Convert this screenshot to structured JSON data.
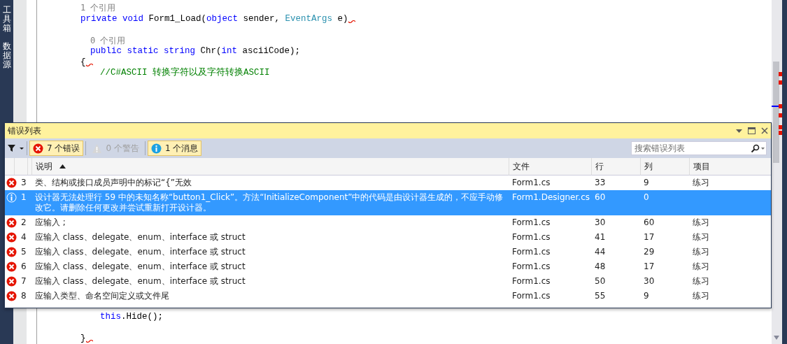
{
  "side_tabs": [
    {
      "label": "工具箱"
    },
    {
      "label": "数据源"
    }
  ],
  "code_lines": [
    {
      "kind": "lens",
      "text": "1 个引用"
    },
    {
      "kind": "code",
      "squiggle": true,
      "segments": [
        {
          "kind": "keyword",
          "text": "private void "
        },
        {
          "kind": "plain",
          "text": "Form1_Load("
        },
        {
          "kind": "keyword",
          "text": "object "
        },
        {
          "kind": "plain",
          "text": "sender, "
        },
        {
          "kind": "type",
          "text": "EventArgs "
        },
        {
          "kind": "plain",
          "text": "e)"
        }
      ]
    },
    {
      "kind": "blank"
    },
    {
      "kind": "lens",
      "text": "0 个引用"
    },
    {
      "kind": "code",
      "squiggle": false,
      "segments": [
        {
          "kind": "keyword",
          "text": "public static string "
        },
        {
          "kind": "plain",
          "text": "Chr("
        },
        {
          "kind": "keyword",
          "text": "int "
        },
        {
          "kind": "plain",
          "text": "asciiCode);"
        }
      ]
    },
    {
      "kind": "code",
      "squiggle": true,
      "segments": [
        {
          "kind": "plain",
          "text": "{"
        }
      ]
    },
    {
      "kind": "code",
      "squiggle": false,
      "segments": [
        {
          "kind": "comment",
          "text": "//C#ASCII 转换字符以及字符转换ASCII"
        }
      ]
    }
  ],
  "code_lines_below": [
    {
      "kind": "code",
      "squiggle": false,
      "segments": [
        {
          "kind": "keyword",
          "text": "this"
        },
        {
          "kind": "plain",
          "text": ".Hide();"
        }
      ]
    },
    {
      "kind": "blank"
    },
    {
      "kind": "code",
      "squiggle": true,
      "segments": [
        {
          "kind": "plain",
          "text": "}"
        }
      ]
    }
  ],
  "error_list": {
    "title": "错误列表",
    "filters": [
      {
        "kind": "error",
        "label": "7 个错误",
        "on": true
      },
      {
        "kind": "warning",
        "label": "0 个警告",
        "on": false
      },
      {
        "kind": "message",
        "label": "1 个消息",
        "on": true
      }
    ],
    "search": {
      "placeholder": "搜索错误列表"
    },
    "columns": [
      {
        "label": "说明",
        "sorted": true
      },
      {
        "label": "文件",
        "sorted": false
      },
      {
        "label": "行",
        "sorted": false
      },
      {
        "label": "列",
        "sorted": false
      },
      {
        "label": "项目",
        "sorted": false
      }
    ],
    "rows": [
      {
        "kind": "error",
        "number": "3",
        "description": "类、结构或接口成员声明中的标记“{”无效",
        "file": "Form1.cs",
        "line": "33",
        "column": "9",
        "project": "练习",
        "selected": false
      },
      {
        "kind": "message",
        "number": "1",
        "description": "设计器无法处理行 59 中的未知名称“button1_Click”。方法“InitializeComponent”中的代码是由设计器生成的，不应手动修改它。请删除任何更改并尝试重新打开设计器。",
        "file": "Form1.Designer.cs",
        "line": "60",
        "column": "0",
        "selected": true
      },
      {
        "kind": "error",
        "number": "2",
        "description": "应输入 ;",
        "file": "Form1.cs",
        "line": "30",
        "column": "60",
        "project": "练习",
        "selected": false
      },
      {
        "kind": "error",
        "number": "4",
        "description": "应输入 class、delegate、enum、interface 或 struct",
        "file": "Form1.cs",
        "line": "41",
        "column": "17",
        "project": "练习",
        "selected": false
      },
      {
        "kind": "error",
        "number": "5",
        "description": "应输入 class、delegate、enum、interface 或 struct",
        "file": "Form1.cs",
        "line": "44",
        "column": "29",
        "project": "练习",
        "selected": false
      },
      {
        "kind": "error",
        "number": "6",
        "description": "应输入 class、delegate、enum、interface 或 struct",
        "file": "Form1.cs",
        "line": "48",
        "column": "17",
        "project": "练习",
        "selected": false
      },
      {
        "kind": "error",
        "number": "7",
        "description": "应输入 class、delegate、enum、interface 或 struct",
        "file": "Form1.cs",
        "line": "50",
        "column": "30",
        "project": "练习",
        "selected": false
      },
      {
        "kind": "error",
        "number": "8",
        "description": "应输入类型、命名空间定义或文件尾",
        "file": "Form1.cs",
        "line": "55",
        "column": "9",
        "project": "练习",
        "selected": false
      }
    ]
  }
}
